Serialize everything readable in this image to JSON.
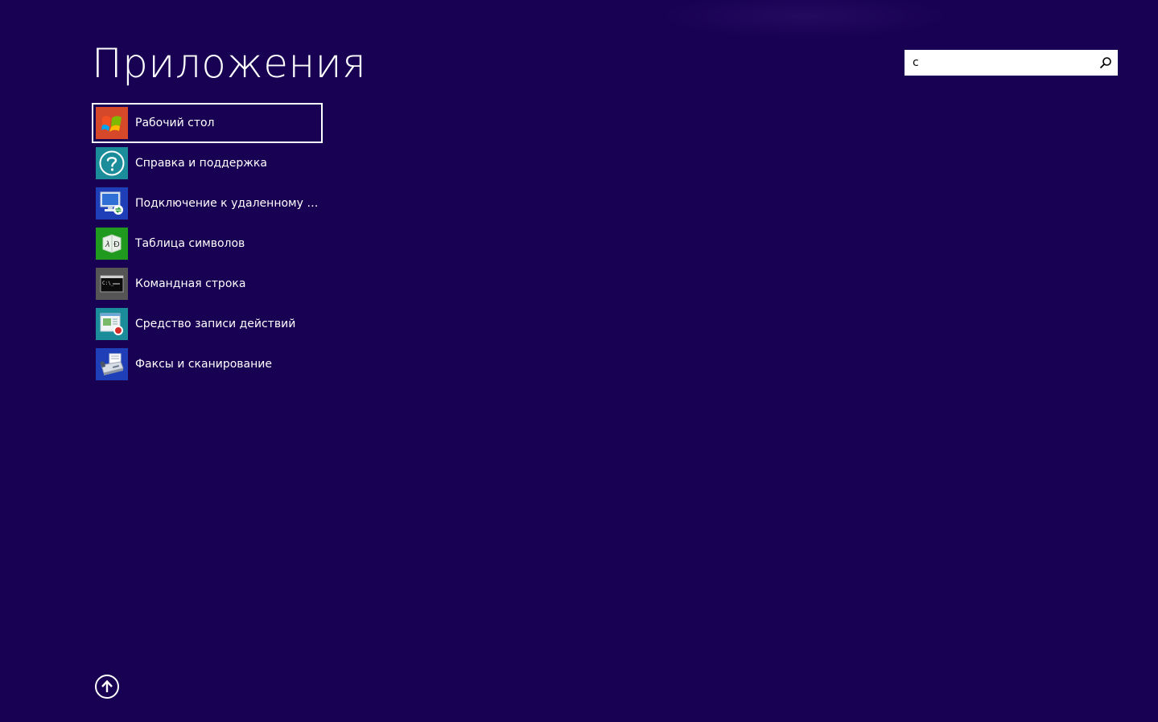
{
  "screen": {
    "title": "Приложения",
    "background_color": "#180052"
  },
  "search": {
    "value": "с",
    "icon": "search-icon"
  },
  "apps": [
    {
      "label": "Рабочий стол",
      "tile_color": "#d6482a",
      "icon": "desktop-icon",
      "selected": true
    },
    {
      "label": "Справка и поддержка",
      "tile_color": "#1a8c9a",
      "icon": "help-icon",
      "selected": false
    },
    {
      "label": "Подключение к удаленному ра...",
      "tile_color": "#1e3fb8",
      "icon": "remote-desktop-icon",
      "selected": false
    },
    {
      "label": "Таблица символов",
      "tile_color": "#1f9a1f",
      "icon": "character-map-icon",
      "selected": false
    },
    {
      "label": "Командная строка",
      "tile_color": "#555555",
      "icon": "command-prompt-icon",
      "selected": false
    },
    {
      "label": "Средство записи действий",
      "tile_color": "#1a8c9a",
      "icon": "steps-recorder-icon",
      "selected": false
    },
    {
      "label": "Факсы и сканирование",
      "tile_color": "#1e3fb8",
      "icon": "fax-scan-icon",
      "selected": false
    }
  ],
  "footer": {
    "scroll_up_icon": "arrow-up-circle-icon"
  }
}
